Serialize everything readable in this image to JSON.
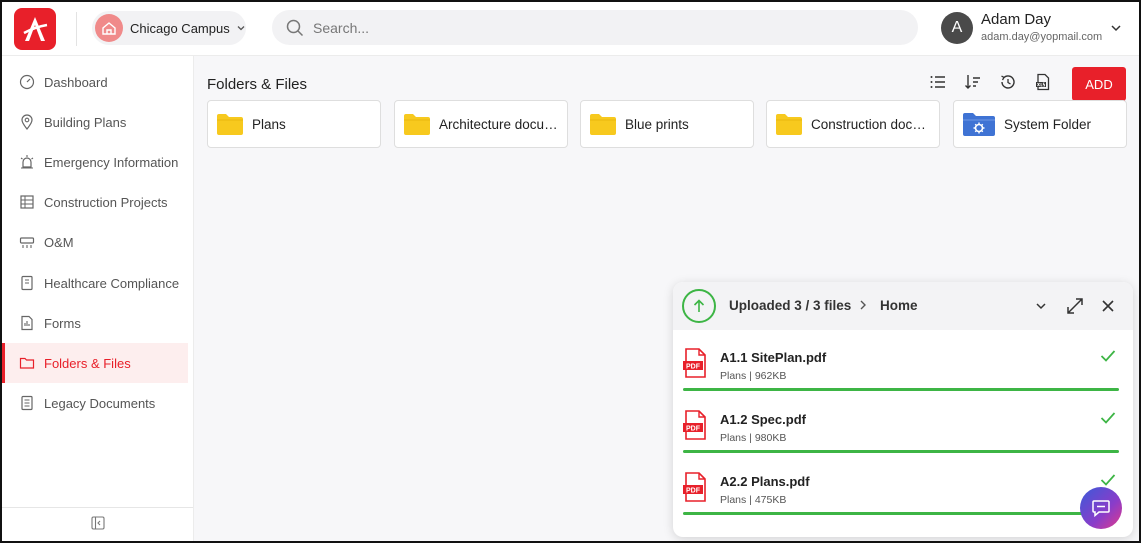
{
  "header": {
    "logo_icon": "brand-a-icon",
    "campus": {
      "label": "Chicago Campus",
      "icon": "campus-building-icon"
    },
    "search": {
      "placeholder": "Search..."
    },
    "user": {
      "initial": "A",
      "name": "Adam Day",
      "email": "adam.day@yopmail.com"
    }
  },
  "sidebar": {
    "items": [
      {
        "label": "Dashboard",
        "icon": "dashboard-gauge-icon",
        "active": false
      },
      {
        "label": "Building Plans",
        "icon": "location-pin-icon",
        "active": false
      },
      {
        "label": "Emergency Information",
        "icon": "alarm-icon",
        "active": false
      },
      {
        "label": "Construction Projects",
        "icon": "construction-icon",
        "active": false
      },
      {
        "label": "O&M",
        "icon": "hvac-icon",
        "active": false
      },
      {
        "label": "Healthcare Compliance",
        "icon": "notebook-icon",
        "active": false
      },
      {
        "label": "Forms",
        "icon": "form-icon",
        "active": false
      },
      {
        "label": "Folders & Files",
        "icon": "folder-icon",
        "active": true
      },
      {
        "label": "Legacy Documents",
        "icon": "documents-icon",
        "active": false
      }
    ],
    "collapse_icon": "collapse-sidebar-icon"
  },
  "main": {
    "title": "Folders & Files",
    "toolbar": [
      "list-view-icon",
      "sort-icon",
      "history-icon",
      "export-xls-icon"
    ],
    "add_label": "ADD",
    "folders": [
      {
        "name": "Plans",
        "icon": "folder-icon"
      },
      {
        "name": "Architecture documents",
        "icon": "folder-icon"
      },
      {
        "name": "Blue prints",
        "icon": "folder-icon"
      },
      {
        "name": "Construction documents",
        "icon": "folder-icon"
      },
      {
        "name": "System Folder",
        "icon": "system-folder-icon"
      }
    ]
  },
  "upload": {
    "status": "Uploaded 3 / 3 files",
    "location": "Home",
    "files": [
      {
        "name": "A1.1 SitePlan.pdf",
        "meta": "Plans | 962KB",
        "progress": 1.0
      },
      {
        "name": "A1.2 Spec.pdf",
        "meta": "Plans | 980KB",
        "progress": 1.0
      },
      {
        "name": "A2.2 Plans.pdf",
        "meta": "Plans | 475KB",
        "progress": 1.0
      }
    ]
  },
  "colors": {
    "brand": "#e8202a",
    "success": "#3db545",
    "folder": "#f7c91e"
  }
}
